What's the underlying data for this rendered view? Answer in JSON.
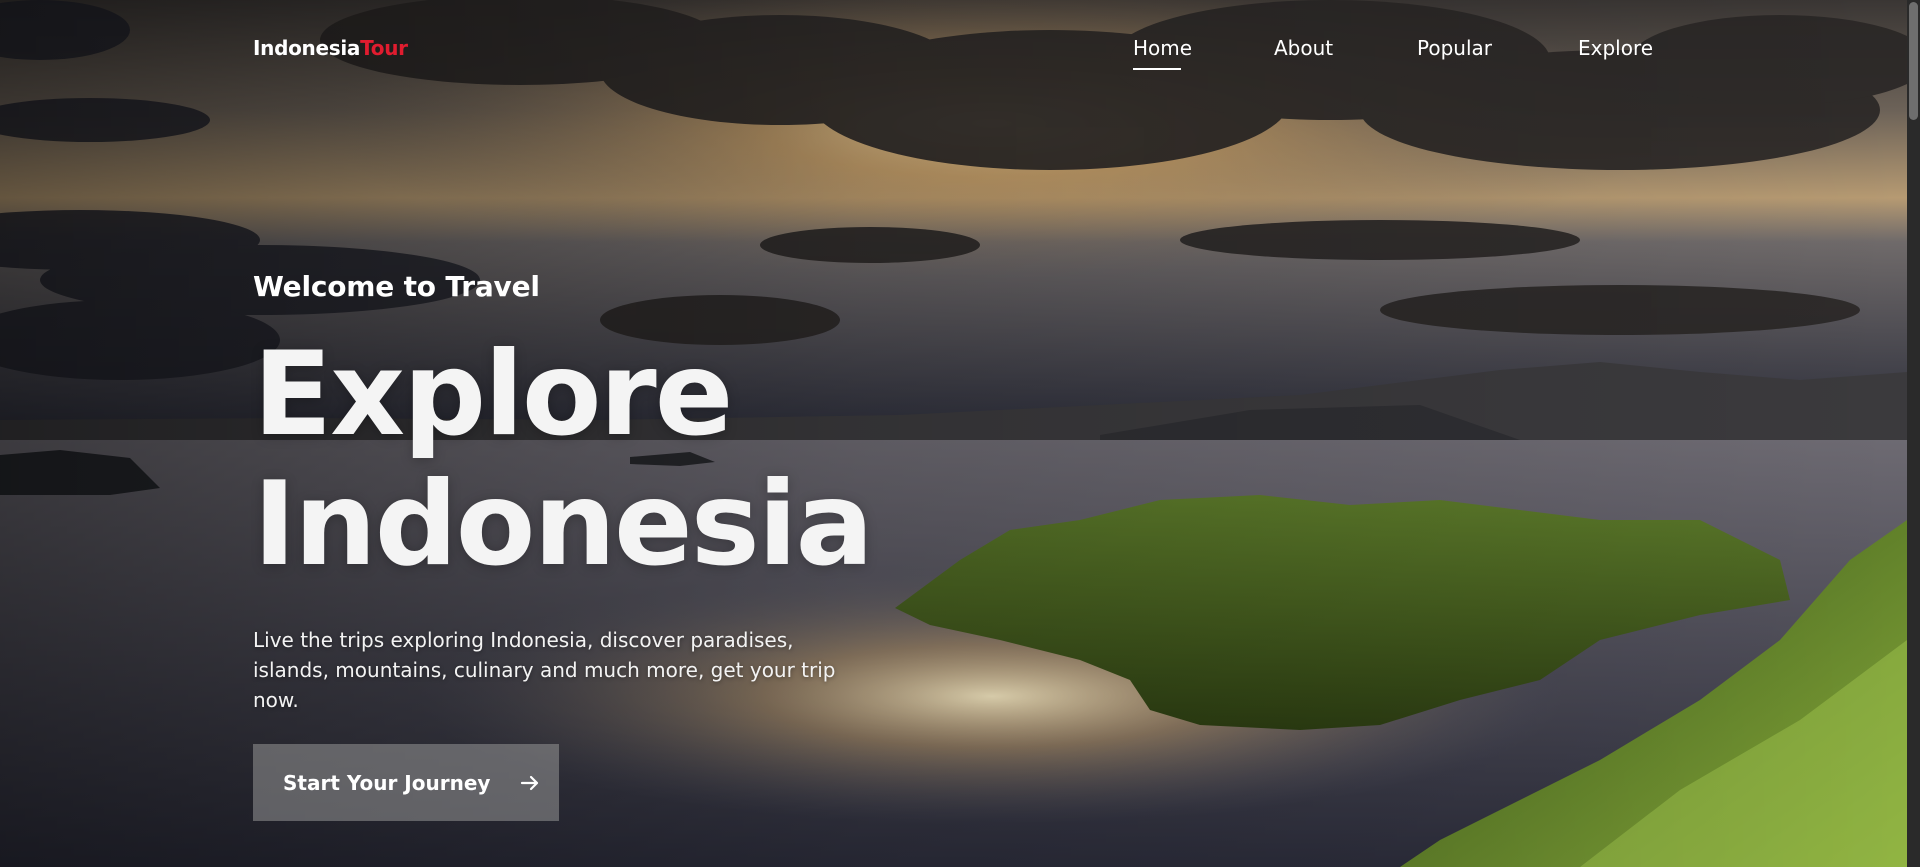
{
  "header": {
    "logo": {
      "part_a": "Indonesia",
      "part_b": "Tour",
      "accent_color": "#e01c2f"
    },
    "nav": [
      {
        "label": "Home",
        "active": true
      },
      {
        "label": "About",
        "active": false
      },
      {
        "label": "Popular",
        "active": false
      },
      {
        "label": "Explore",
        "active": false
      }
    ]
  },
  "hero": {
    "subtitle": "Welcome to Travel",
    "title_line1": "Explore",
    "title_line2": "Indonesia",
    "description": "Live the trips exploring Indonesia, discover paradises, islands, mountains, culinary and much more, get your trip now.",
    "cta": {
      "label": "Start Your Journey",
      "icon": "arrow-right-icon"
    }
  },
  "background": {
    "subject": "sunset-over-islands-photo"
  }
}
